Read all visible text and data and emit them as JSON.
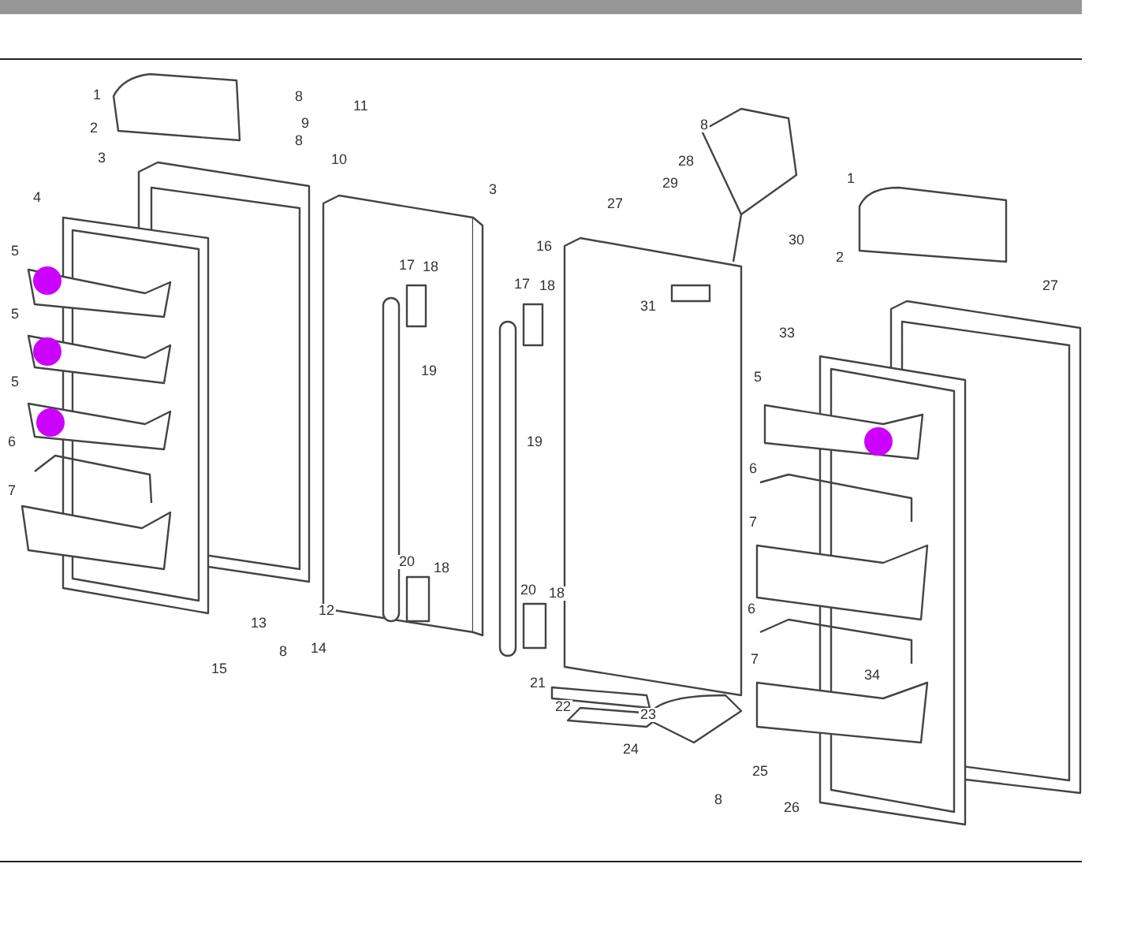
{
  "diagram": {
    "callouts": [
      {
        "label": "1"
      },
      {
        "label": "2"
      },
      {
        "label": "3"
      },
      {
        "label": "4"
      },
      {
        "label": "5"
      },
      {
        "label": "5"
      },
      {
        "label": "5"
      },
      {
        "label": "6"
      },
      {
        "label": "7"
      },
      {
        "label": "8"
      },
      {
        "label": "9"
      },
      {
        "label": "8"
      },
      {
        "label": "10"
      },
      {
        "label": "11"
      },
      {
        "label": "12"
      },
      {
        "label": "13"
      },
      {
        "label": "14"
      },
      {
        "label": "15"
      },
      {
        "label": "8"
      },
      {
        "label": "3"
      },
      {
        "label": "16"
      },
      {
        "label": "17"
      },
      {
        "label": "18"
      },
      {
        "label": "19"
      },
      {
        "label": "17"
      },
      {
        "label": "18"
      },
      {
        "label": "19"
      },
      {
        "label": "20"
      },
      {
        "label": "18"
      },
      {
        "label": "20"
      },
      {
        "label": "18"
      },
      {
        "label": "27"
      },
      {
        "label": "31"
      },
      {
        "label": "21"
      },
      {
        "label": "22"
      },
      {
        "label": "23"
      },
      {
        "label": "24"
      },
      {
        "label": "25"
      },
      {
        "label": "8"
      },
      {
        "label": "26"
      },
      {
        "label": "8"
      },
      {
        "label": "28"
      },
      {
        "label": "29"
      },
      {
        "label": "30"
      },
      {
        "label": "1"
      },
      {
        "label": "2"
      },
      {
        "label": "27"
      },
      {
        "label": "33"
      },
      {
        "label": "5"
      },
      {
        "label": "6"
      },
      {
        "label": "7"
      },
      {
        "label": "6"
      },
      {
        "label": "7"
      },
      {
        "label": "34"
      }
    ]
  }
}
